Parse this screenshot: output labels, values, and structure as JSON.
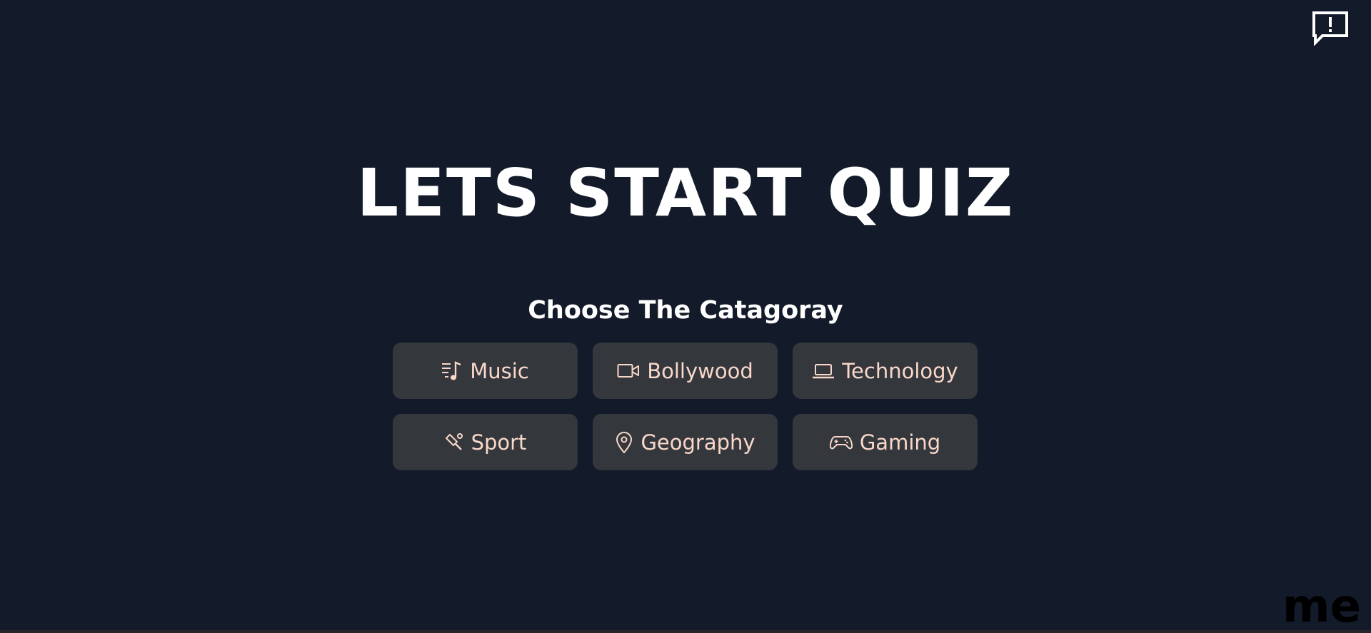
{
  "page": {
    "title": "LETS START QUIZ",
    "subtitle": "Choose The Catagoray",
    "corner_brand": "me",
    "feedback_icon": "feedback-icon"
  },
  "categories": [
    {
      "label": "Music",
      "icon": "music-icon"
    },
    {
      "label": "Bollywood",
      "icon": "video-camera-icon"
    },
    {
      "label": "Technology",
      "icon": "laptop-icon"
    },
    {
      "label": "Sport",
      "icon": "cricket-bat-icon"
    },
    {
      "label": "Geography",
      "icon": "map-pin-icon"
    },
    {
      "label": "Gaming",
      "icon": "gamepad-icon"
    }
  ],
  "colors": {
    "background": "#131a29",
    "button_bg": "#34383d",
    "button_text": "#f9d7c9",
    "title_text": "#ffffff"
  }
}
